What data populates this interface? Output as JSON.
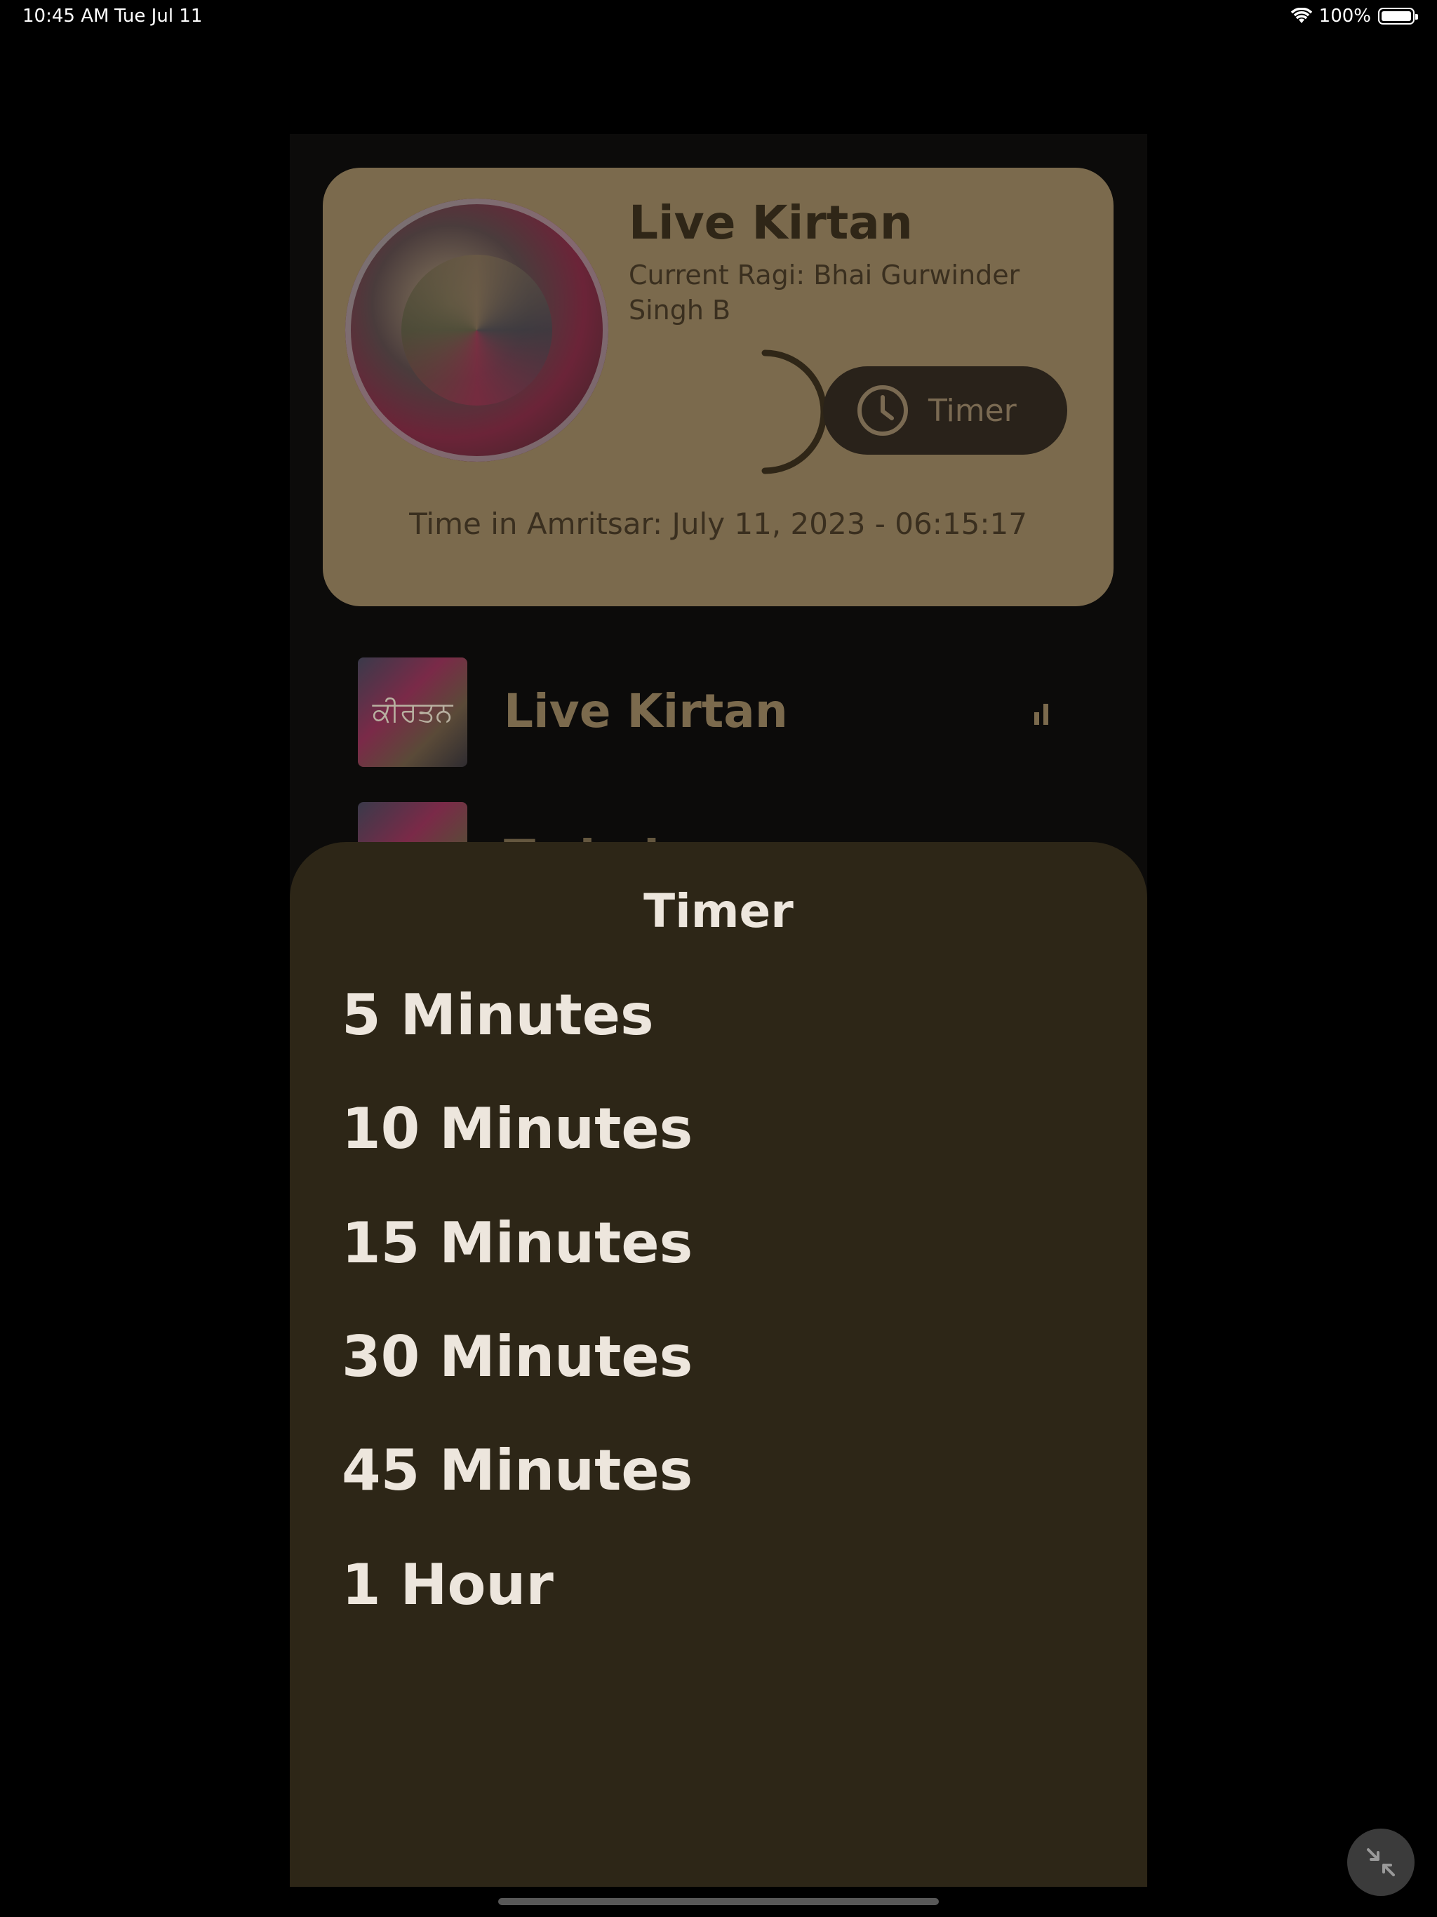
{
  "status_bar": {
    "time": "10:45 AM",
    "date": "Tue Jul 11",
    "battery": "100%"
  },
  "now_playing": {
    "title": "Live Kirtan",
    "subtitle": "Current Ragi: Bhai Gurwinder Singh B",
    "timer_button": "Timer",
    "footer": "Time in Amritsar: July 11, 2023 - 06:15:17"
  },
  "stations": [
    {
      "title": "Live Kirtan",
      "thumb_text": "ਕੀਰਤਨ",
      "playing": true
    },
    {
      "title": "Tu hai",
      "thumb_text": "",
      "playing": false
    }
  ],
  "timer_sheet": {
    "title": "Timer",
    "options": [
      "5 Minutes",
      "10 Minutes",
      "15 Minutes",
      "30 Minutes",
      "45 Minutes",
      "1 Hour"
    ]
  },
  "colors": {
    "card": "#7b6a4d",
    "sheet": "#2d2617",
    "option_text": "#ede6dd",
    "timer_button": "#29221a"
  },
  "icons": {
    "clock": "clock-icon",
    "equalizer": "equalizer-icon",
    "collapse": "collapse-arrows-icon",
    "wifi": "wifi-icon",
    "battery": "battery-icon"
  }
}
